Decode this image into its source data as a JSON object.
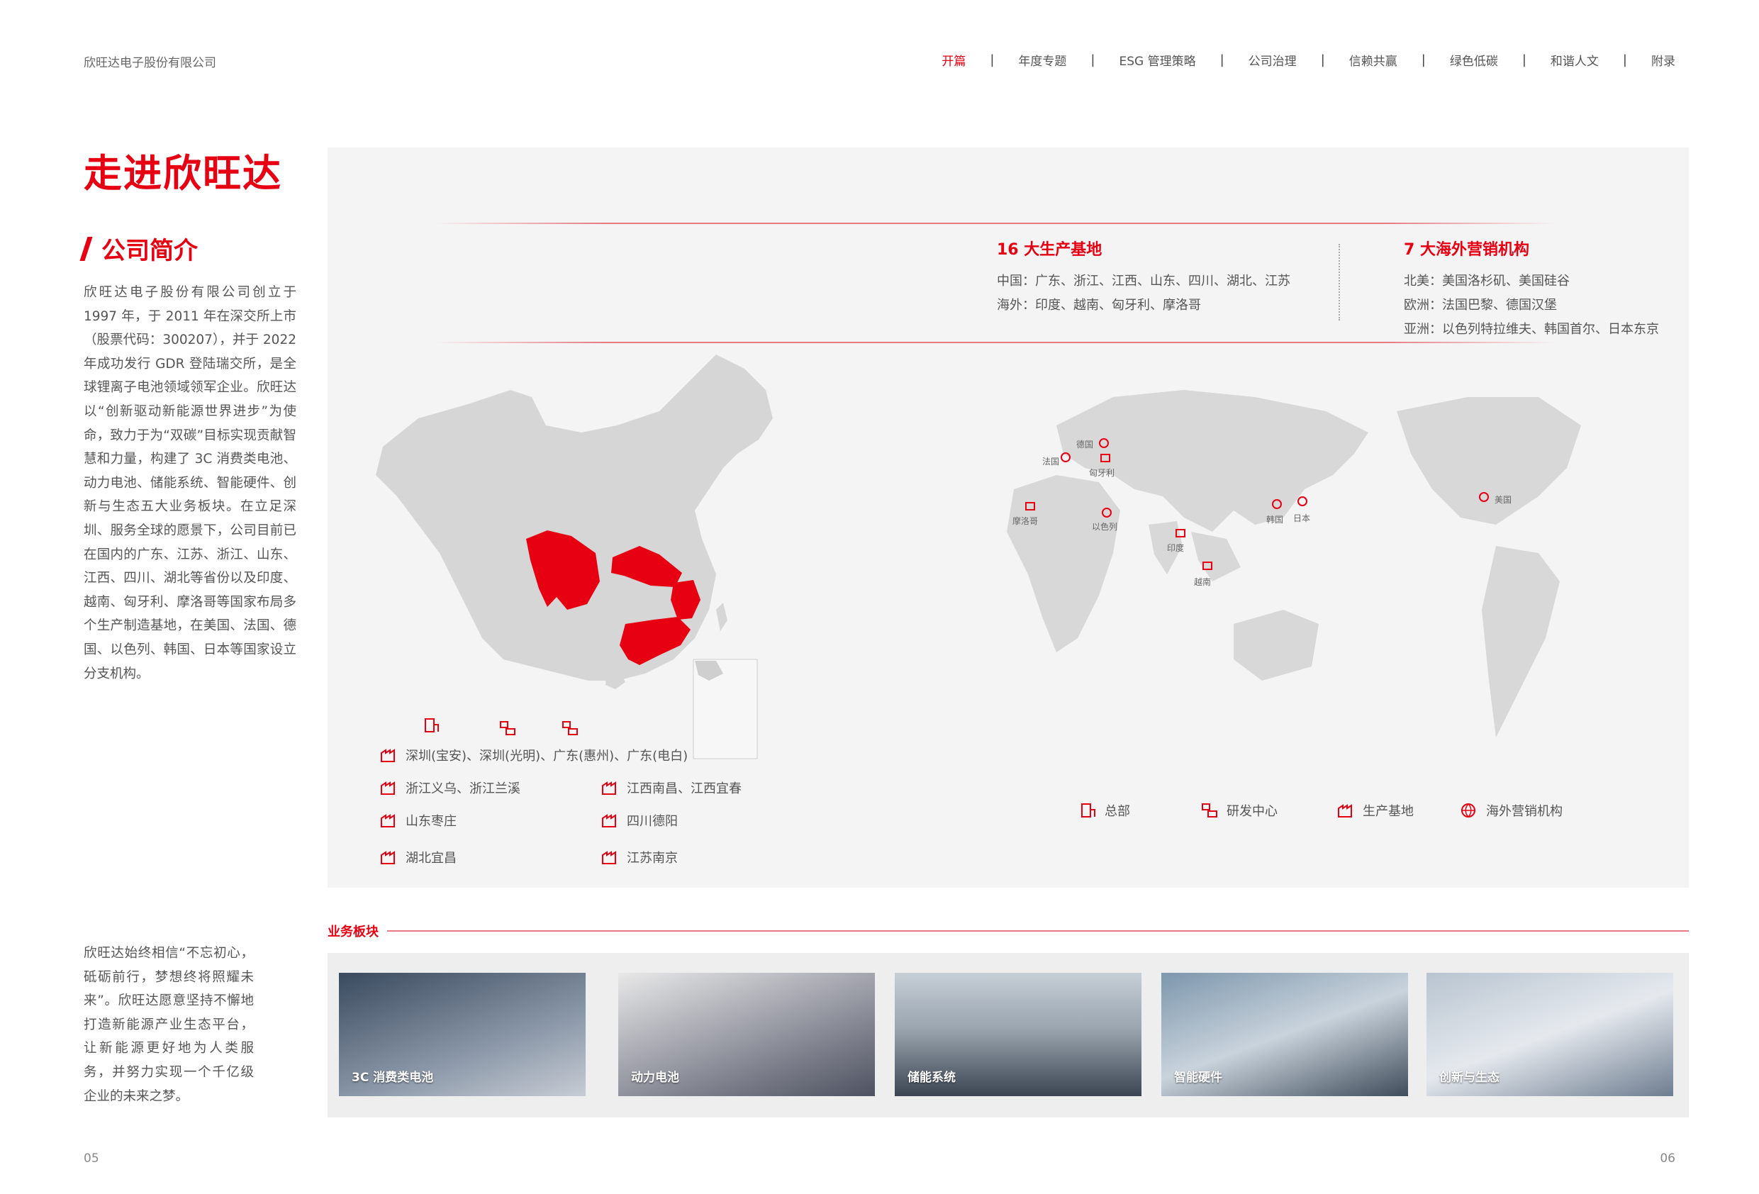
{
  "header": {
    "company": "欣旺达电子股份有限公司",
    "nav": [
      {
        "label": "开篇",
        "active": true
      },
      {
        "label": "年度专题",
        "active": false
      },
      {
        "label": "ESG 管理策略",
        "active": false
      },
      {
        "label": "公司治理",
        "active": false
      },
      {
        "label": "信赖共赢",
        "active": false
      },
      {
        "label": "绿色低碳",
        "active": false
      },
      {
        "label": "和谐人文",
        "active": false
      },
      {
        "label": "附录",
        "active": false
      }
    ],
    "separator": "|"
  },
  "title": "走进欣旺达",
  "section": "公司简介",
  "intro": "欣旺达电子股份有限公司创立于1997 年，于 2011 年在深交所上市（股票代码：300207），并于 2022年成功发行 GDR 登陆瑞交所，是全球锂离子电池领域领军企业。欣旺达以“创新驱动新能源世界进步”为使命，致力于为“双碳”目标实现贡献智慧和力量，构建了 3C 消费类电池、动力电池、储能系统、智能硬件、创新与生态五大业务板块。在立足深圳、服务全球的愿景下，公司目前已在国内的广东、江苏、浙江、山东、江西、四川、湖北等省份以及印度、越南、匈牙利、摩洛哥等国家布局多个生产制造基地，在美国、法国、德国、以色列、韩国、日本等国家设立分支机构。",
  "closing": "欣旺达始终相信“不忘初心，砥砺前行，梦想终将照耀未来”。欣旺达愿意坚持不懈地打造新能源产业生态平台，让新能源更好地为人类服务，并努力实现一个千亿级企业的未来之梦。",
  "production": {
    "heading": "16 大生产基地",
    "lines": [
      "中国：广东、浙江、江西、山东、四川、湖北、江苏",
      "海外：印度、越南、匈牙利、摩洛哥"
    ]
  },
  "marketing": {
    "heading": "7 大海外营销机构",
    "lines": [
      "北美：美国洛杉矶、美国硅谷",
      "欧洲：法国巴黎、德国汉堡",
      "亚洲：以色列特拉维夫、韩国首尔、日本东京"
    ]
  },
  "china_legend": [
    "深圳(宝安)、深圳(光明)、广东(惠州)、广东(电白)",
    "浙江义乌、浙江兰溪",
    "江西南昌、江西宜春",
    "山东枣庄",
    "四川德阳",
    "湖北宜昌",
    "江苏南京"
  ],
  "world_labels": {
    "germany": "德国",
    "france": "法国",
    "hungary": "匈牙利",
    "morocco": "摩洛哥",
    "israel": "以色列",
    "india": "印度",
    "vietnam": "越南",
    "korea": "韩国",
    "japan": "日本",
    "usa": "美国"
  },
  "world_legend": [
    "总部",
    "研发中心",
    "生产基地",
    "海外营销机构"
  ],
  "business": {
    "title": "业务板块",
    "cards": [
      "3C 消费类电池",
      "动力电池",
      "储能系统",
      "智能硬件",
      "创新与生态"
    ]
  },
  "pages": {
    "left": "05",
    "right": "06"
  },
  "colors": {
    "accent": "#e60012",
    "map_gray": "#d6d6d6",
    "panel": "#f4f4f4"
  }
}
